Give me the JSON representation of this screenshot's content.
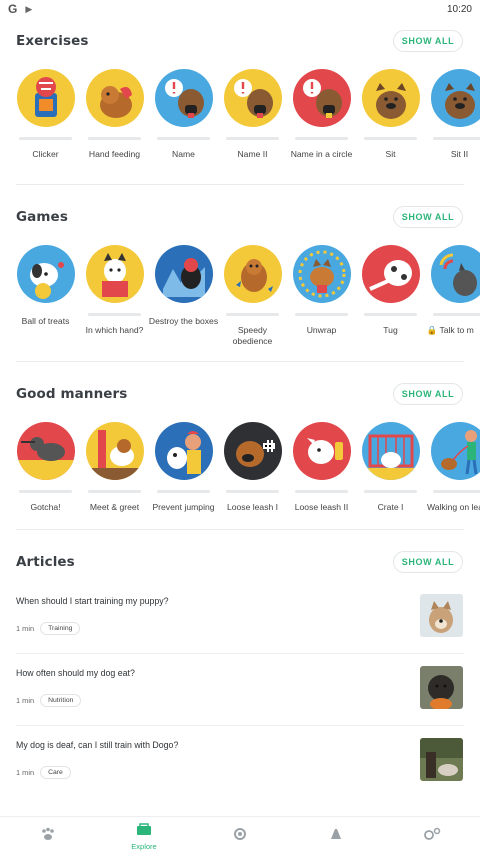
{
  "status_bar": {
    "left_icon": "G",
    "time": "10:20"
  },
  "sections": [
    {
      "title": "Exercises",
      "show_all": "SHOW ALL",
      "items": [
        {
          "label": "Clicker",
          "bg": "#f3c93a"
        },
        {
          "label": "Hand feeding",
          "bg": "#f3c93a"
        },
        {
          "label": "Name",
          "bg": "#4aa8e0"
        },
        {
          "label": "Name II",
          "bg": "#f3c93a"
        },
        {
          "label": "Name in a circle",
          "bg": "#e2474b"
        },
        {
          "label": "Sit",
          "bg": "#f3c93a"
        },
        {
          "label": "Sit II",
          "bg": "#4aa8e0"
        }
      ]
    },
    {
      "title": "Games",
      "show_all": "SHOW ALL",
      "items": [
        {
          "label": "Ball of treats",
          "bg": "#4aa8e0"
        },
        {
          "label": "In which hand?",
          "bg": "#f3c93a"
        },
        {
          "label": "Destroy the boxes",
          "bg": "#2a6fb7"
        },
        {
          "label": "Speedy obedience",
          "bg": "#f3c93a"
        },
        {
          "label": "Unwrap",
          "bg": "#4aa8e0"
        },
        {
          "label": "Tug",
          "bg": "#e2474b"
        },
        {
          "label": "Talk to m",
          "bg": "#4aa8e0",
          "locked": true
        }
      ]
    },
    {
      "title": "Good manners",
      "show_all": "SHOW ALL",
      "items": [
        {
          "label": "Gotcha!",
          "bg": "#e2474b"
        },
        {
          "label": "Meet & greet",
          "bg": "#f3c93a"
        },
        {
          "label": "Prevent jumping",
          "bg": "#2a6fb7"
        },
        {
          "label": "Loose leash I",
          "bg": "#2f3034"
        },
        {
          "label": "Loose leash II",
          "bg": "#e2474b"
        },
        {
          "label": "Crate I",
          "bg": "#4aa8e0"
        },
        {
          "label": "Walking on leash",
          "bg": "#4aa8e0"
        }
      ]
    }
  ],
  "articles": {
    "title": "Articles",
    "show_all": "SHOW ALL",
    "items": [
      {
        "title": "When should I start training my puppy?",
        "time": "1 min",
        "tag": "Training",
        "thumb": "#c9a27a"
      },
      {
        "title": "How often should my dog eat?",
        "time": "1 min",
        "tag": "Nutrition",
        "thumb": "#5a534c"
      },
      {
        "title": "My dog is deaf, can I still train with Dogo?",
        "time": "1 min",
        "tag": "Care",
        "thumb": "#6d7a52"
      }
    ]
  },
  "bottom_nav": [
    {
      "icon": "paw-icon",
      "label": ""
    },
    {
      "icon": "explore-icon",
      "label": "Explore",
      "active": true
    },
    {
      "icon": "clicker-icon",
      "label": ""
    },
    {
      "icon": "whistle-icon",
      "label": ""
    },
    {
      "icon": "more-icon",
      "label": ""
    }
  ],
  "colors": {
    "accent": "#2bb57a"
  }
}
